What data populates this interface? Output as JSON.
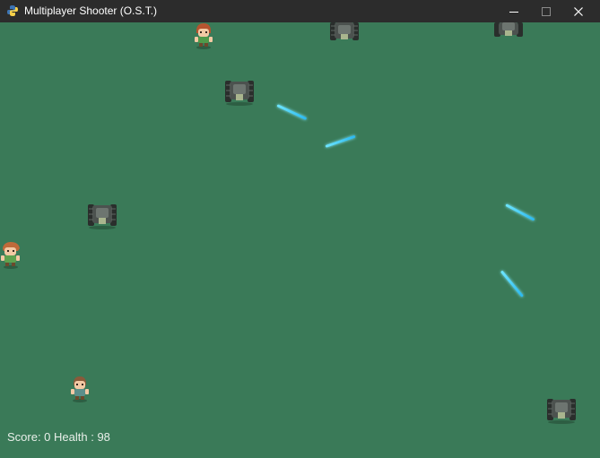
{
  "window": {
    "title": "Multiplayer Shooter (O.S.T.)",
    "icon": "python-icon",
    "controls": [
      "minimize-icon",
      "maximize-icon",
      "close-icon"
    ]
  },
  "hud": {
    "score_label": "Score:",
    "score": 0,
    "health_label": "Health :",
    "health": 98,
    "text": "Score: 0 Health : 98"
  },
  "sprites": {
    "players": [
      "player-sprite",
      "player-sprite",
      "player-sprite"
    ],
    "enemies": [
      "tank-enemy-sprite",
      "tank-enemy-sprite",
      "tank-enemy-sprite",
      "tank-enemy-sprite",
      "tank-enemy-sprite"
    ],
    "projectiles": [
      "laser-bolt",
      "laser-bolt",
      "laser-bolt",
      "laser-bolt"
    ]
  },
  "colors": {
    "background": "#3a7a58",
    "titlebar": "#2c2c2c",
    "laser": "#4fd3f5"
  }
}
